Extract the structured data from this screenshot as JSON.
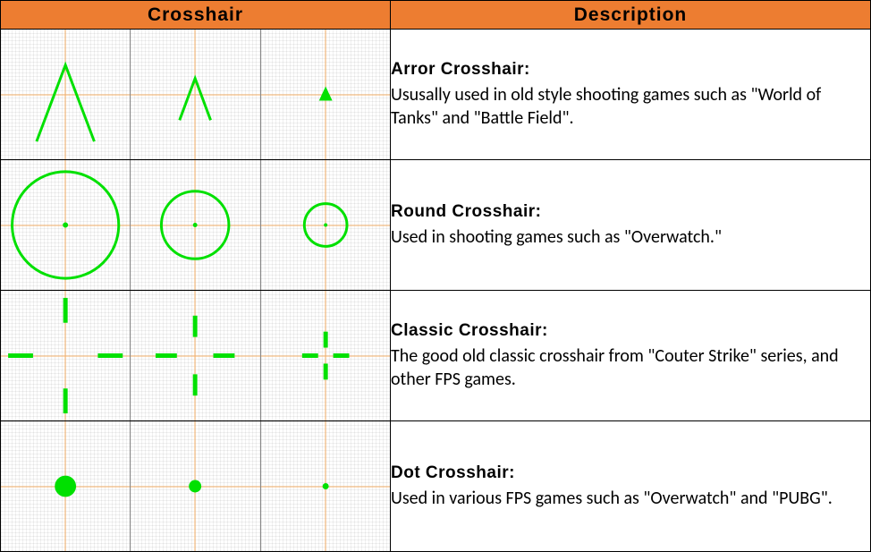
{
  "header": {
    "col_preview": "Crosshair",
    "col_desc": "Description"
  },
  "colors": {
    "header_bg": "#ed7d31",
    "crosshair": "#00e000",
    "guide": "#f5b06a"
  },
  "rows": [
    {
      "type": "arrow",
      "title": "Arror Crosshair:",
      "body": "Ususally used in old style shooting games such as \"World of Tanks\" and \"Battle Field\"."
    },
    {
      "type": "round",
      "title": "Round Crosshair:",
      "body": "Used in shooting games such as \"Overwatch.\""
    },
    {
      "type": "classic",
      "title": "Classic Crosshair:",
      "body": "The good old classic crosshair from \"Couter Strike\" series, and other FPS games."
    },
    {
      "type": "dot",
      "title": "Dot Crosshair:",
      "body": "Used in various FPS games such as \"Overwatch\" and \"PUBG\"."
    }
  ]
}
